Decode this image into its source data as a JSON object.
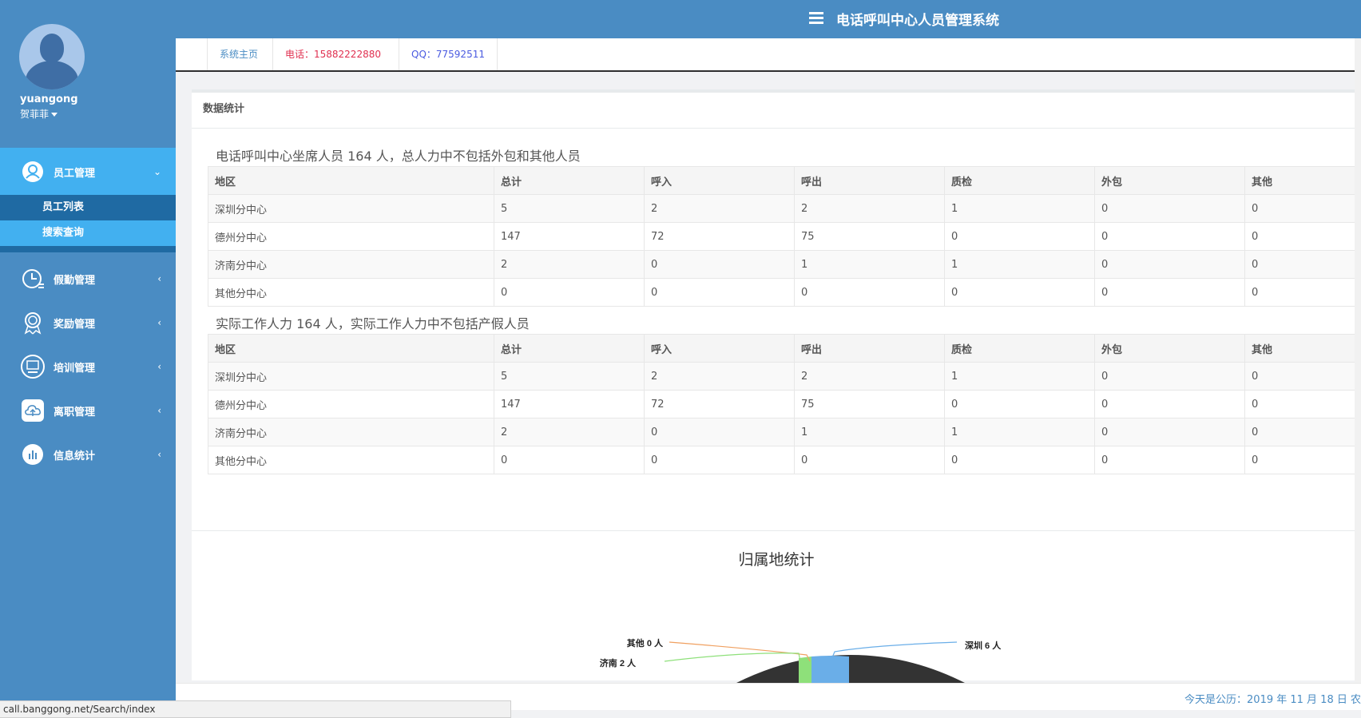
{
  "header": {
    "title": "电话呼叫中心人员管理系统"
  },
  "user": {
    "login": "yuangong",
    "name": "贺菲菲"
  },
  "sidebar": {
    "items": [
      {
        "label": "员工管理",
        "arrow": "⌄"
      },
      {
        "label": "假勤管理",
        "arrow": "‹"
      },
      {
        "label": "奖励管理",
        "arrow": "‹"
      },
      {
        "label": "培训管理",
        "arrow": "‹"
      },
      {
        "label": "离职管理",
        "arrow": "‹"
      },
      {
        "label": "信息统计",
        "arrow": "‹"
      }
    ],
    "subitems": [
      {
        "label": "员工列表"
      },
      {
        "label": "搜索查询"
      }
    ]
  },
  "tabs": {
    "home": "系统主页",
    "phone": "电话：15882222880",
    "qq": "QQ：77592511"
  },
  "panel": {
    "title": "数据统计",
    "section1": "电话呼叫中心坐席人员 164 人，总人力中不包括外包和其他人员",
    "section2": "实际工作人力 164 人，实际工作人力中不包括产假人员",
    "columns": [
      "地区",
      "总计",
      "呼入",
      "呼出",
      "质检",
      "外包",
      "其他"
    ],
    "table1": [
      [
        "深圳分中心",
        "5",
        "2",
        "2",
        "1",
        "0",
        "0"
      ],
      [
        "德州分中心",
        "147",
        "72",
        "75",
        "0",
        "0",
        "0"
      ],
      [
        "济南分中心",
        "2",
        "0",
        "1",
        "1",
        "0",
        "0"
      ],
      [
        "其他分中心",
        "0",
        "0",
        "0",
        "0",
        "0",
        "0"
      ]
    ],
    "table2": [
      [
        "深圳分中心",
        "5",
        "2",
        "2",
        "1",
        "0",
        "0"
      ],
      [
        "德州分中心",
        "147",
        "72",
        "75",
        "0",
        "0",
        "0"
      ],
      [
        "济南分中心",
        "2",
        "0",
        "1",
        "1",
        "0",
        "0"
      ],
      [
        "其他分中心",
        "0",
        "0",
        "0",
        "0",
        "0",
        "0"
      ]
    ]
  },
  "chart_data": {
    "type": "pie",
    "title": "归属地统计",
    "labels": [
      "其他 0 人",
      "济南 2 人",
      "深圳 6 人"
    ],
    "values": [
      0,
      2,
      6
    ],
    "colors": [
      "#f0a060",
      "#8ee07a",
      "#6aaee8"
    ]
  },
  "footer": {
    "date": "今天是公历：2019 年 11 月 18 日   农"
  },
  "status": {
    "url": "call.banggong.net/Search/index"
  }
}
